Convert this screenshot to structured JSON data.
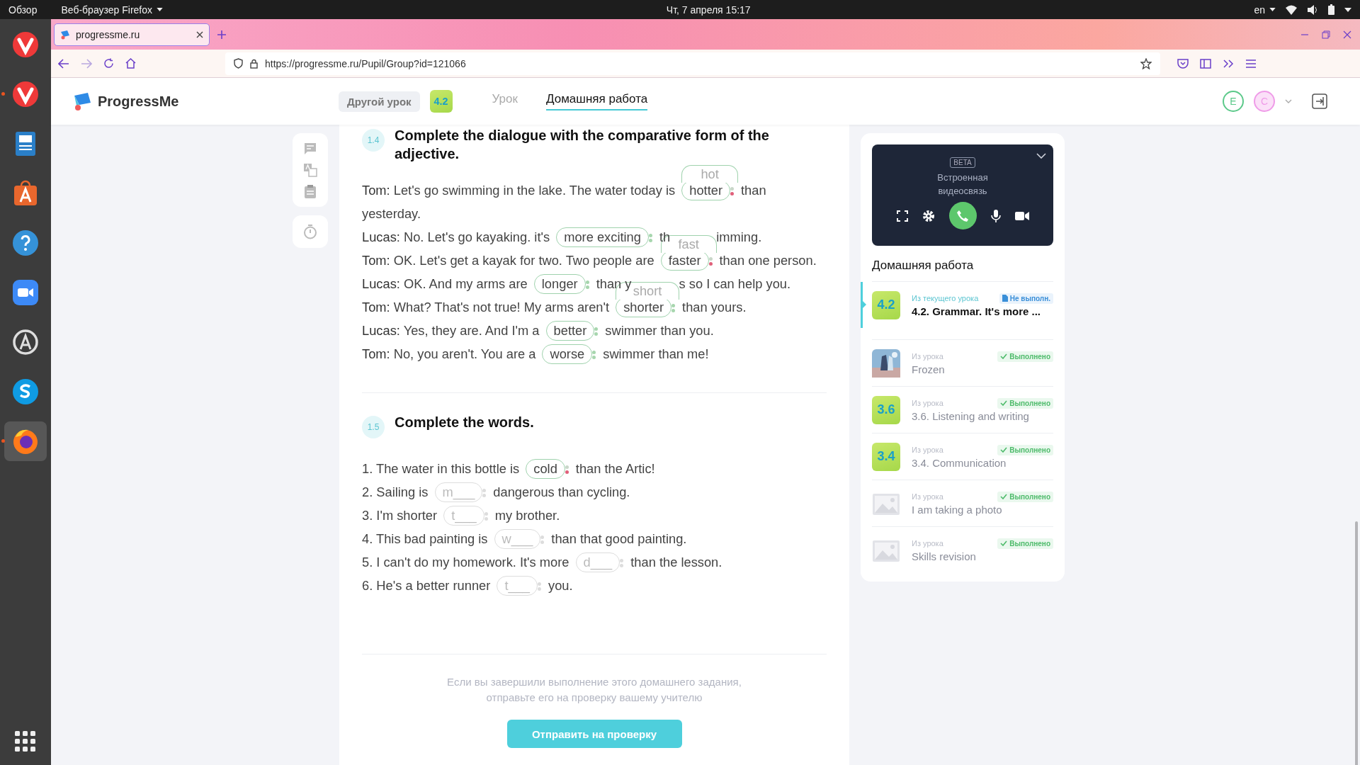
{
  "system_bar": {
    "activities": "Обзор",
    "app_menu": "Веб-браузер Firefox",
    "clock": "Чт, 7 апреля  15:17",
    "language": "en"
  },
  "dock": [
    {
      "kind": "vivaldi",
      "running": false,
      "selected": false
    },
    {
      "kind": "vivaldi",
      "running": true,
      "selected": false
    },
    {
      "kind": "writer",
      "running": false,
      "selected": false
    },
    {
      "kind": "store",
      "running": false,
      "selected": false
    },
    {
      "kind": "help",
      "running": false,
      "selected": false
    },
    {
      "kind": "video",
      "running": false,
      "selected": false
    },
    {
      "kind": "updater",
      "running": false,
      "selected": false
    },
    {
      "kind": "skype",
      "running": false,
      "selected": false
    },
    {
      "kind": "firefox",
      "running": true,
      "selected": true
    }
  ],
  "browser": {
    "tab_title": "progressme.ru",
    "url": "https://progressme.ru/Pupil/Group?id=121066"
  },
  "header": {
    "brand": "ProgressMe",
    "other_lesson": "Другой урок",
    "lesson_badge": "4.2",
    "tabs": [
      {
        "label": "Урок",
        "selected": false
      },
      {
        "label": "Домашняя работа",
        "selected": true
      }
    ],
    "avatars": [
      {
        "letter": "E",
        "color": "#5cc98a"
      },
      {
        "letter": "C",
        "color": "#ef9be8"
      }
    ]
  },
  "exercises": [
    {
      "number": "1.4",
      "title": "Complete the dialogue with the comparative form of the adjective.",
      "lines": [
        {
          "speaker": "Tom:",
          "parts": [
            {
              "kind": "text",
              "text": "Let's go swimming in the lake. The water today is"
            },
            {
              "kind": "gap",
              "hint": "hot",
              "value": "hotter",
              "wrong": true
            },
            {
              "kind": "text",
              "text": "than"
            },
            {
              "kind": "text",
              "text": "yesterday."
            }
          ]
        },
        {
          "speaker": "Lucas:",
          "parts": [
            {
              "kind": "text",
              "text": "No. Let's go kayaking. it's"
            },
            {
              "kind": "gap",
              "value": "more exciting",
              "wrong": false
            },
            {
              "kind": "text",
              "text": "th"
            },
            {
              "kind": "covered"
            },
            {
              "kind": "text",
              "text": "imming."
            }
          ]
        },
        {
          "speaker": "Tom:",
          "parts": [
            {
              "kind": "text",
              "text": "OK. Let's get a kayak for two. Two people are"
            },
            {
              "kind": "gap",
              "hint": "fast",
              "value": "faster",
              "wrong": true
            },
            {
              "kind": "text",
              "text": "than one person."
            }
          ]
        },
        {
          "speaker": "Lucas:",
          "parts": [
            {
              "kind": "text",
              "text": "OK. And my arms are"
            },
            {
              "kind": "gap",
              "value": "longer",
              "wrong": false
            },
            {
              "kind": "text",
              "text": "than y"
            },
            {
              "kind": "covered"
            },
            {
              "kind": "text",
              "text": "s so I can help you."
            }
          ]
        },
        {
          "speaker": "Tom:",
          "parts": [
            {
              "kind": "text",
              "text": "What? That's not true! My arms aren't"
            },
            {
              "kind": "gap",
              "hint": "short",
              "value": "shorter",
              "wrong": false
            },
            {
              "kind": "text",
              "text": "than yours."
            }
          ]
        },
        {
          "speaker": "Lucas:",
          "parts": [
            {
              "kind": "text",
              "text": "Yes, they are. And I'm a"
            },
            {
              "kind": "gap",
              "value": "better",
              "wrong": false
            },
            {
              "kind": "text",
              "text": "swimmer than you."
            }
          ]
        },
        {
          "speaker": "Tom:",
          "parts": [
            {
              "kind": "text",
              "text": "No, you aren't. You are a"
            },
            {
              "kind": "gap",
              "value": "worse",
              "wrong": false
            },
            {
              "kind": "text",
              "text": "swimmer than me!"
            }
          ]
        }
      ]
    },
    {
      "number": "1.5",
      "title": "Complete the words.",
      "lines": [
        {
          "parts": [
            {
              "kind": "text",
              "text": "1. The water in this bottle is"
            },
            {
              "kind": "gap",
              "value": "cold",
              "wrong": true
            },
            {
              "kind": "text",
              "text": "than the Artic!"
            }
          ]
        },
        {
          "parts": [
            {
              "kind": "text",
              "text": "2. Sailing is"
            },
            {
              "kind": "gap",
              "placeholder": "m___"
            },
            {
              "kind": "text",
              "text": "dangerous than cycling."
            }
          ]
        },
        {
          "parts": [
            {
              "kind": "text",
              "text": "3. I'm shorter"
            },
            {
              "kind": "gap",
              "placeholder": "t___"
            },
            {
              "kind": "text",
              "text": "my brother."
            }
          ]
        },
        {
          "parts": [
            {
              "kind": "text",
              "text": "4. This bad painting is"
            },
            {
              "kind": "gap",
              "placeholder": "w___"
            },
            {
              "kind": "text",
              "text": "than that good painting."
            }
          ]
        },
        {
          "parts": [
            {
              "kind": "text",
              "text": "5. I can't do my homework. It's more"
            },
            {
              "kind": "gap",
              "placeholder": "d___"
            },
            {
              "kind": "text",
              "text": "than the lesson."
            }
          ]
        },
        {
          "parts": [
            {
              "kind": "text",
              "text": "6. He's a better runner"
            },
            {
              "kind": "gap",
              "placeholder": "t___"
            },
            {
              "kind": "text",
              "text": "you."
            }
          ]
        }
      ]
    }
  ],
  "submit": {
    "note": "Если вы завершили выполнение этого домашнего задания, отправьте его на проверку вашему учителю",
    "button": "Отправить на проверку"
  },
  "video_call": {
    "badge": "BETA",
    "title": "Встроенная видеосвязь"
  },
  "homework": {
    "title": "Домашняя работа",
    "items": [
      {
        "source": "Из текущего урока",
        "title": "4.2. Grammar. It's more ...",
        "status": {
          "kind": "pending",
          "label": "Не выполн."
        },
        "thumb": {
          "kind": "label",
          "label": "4.2"
        },
        "selected": true
      },
      {
        "source": "Из урока",
        "title": "Frozen",
        "status": {
          "kind": "done",
          "label": "Выполнено"
        },
        "selected": false
      },
      {
        "source": "Из урока",
        "title": "3.6. Listening and writing",
        "status": {
          "kind": "done",
          "label": "Выполнено"
        },
        "thumb": {
          "kind": "label",
          "label": "3.6"
        },
        "selected": false
      },
      {
        "source": "Из урока",
        "title": "3.4. Communication",
        "status": {
          "kind": "done",
          "label": "Выполнено"
        },
        "thumb": {
          "kind": "label",
          "label": "3.4"
        },
        "selected": false
      },
      {
        "source": "Из урока",
        "title": "I am taking a photo",
        "status": {
          "kind": "done",
          "label": "Выполнено"
        },
        "thumb": {
          "kind": "empty"
        },
        "selected": false
      },
      {
        "source": "Из урока",
        "title": "Skills revision",
        "status": {
          "kind": "done",
          "label": "Выполнено"
        },
        "thumb": {
          "kind": "empty"
        },
        "selected": false
      }
    ]
  }
}
